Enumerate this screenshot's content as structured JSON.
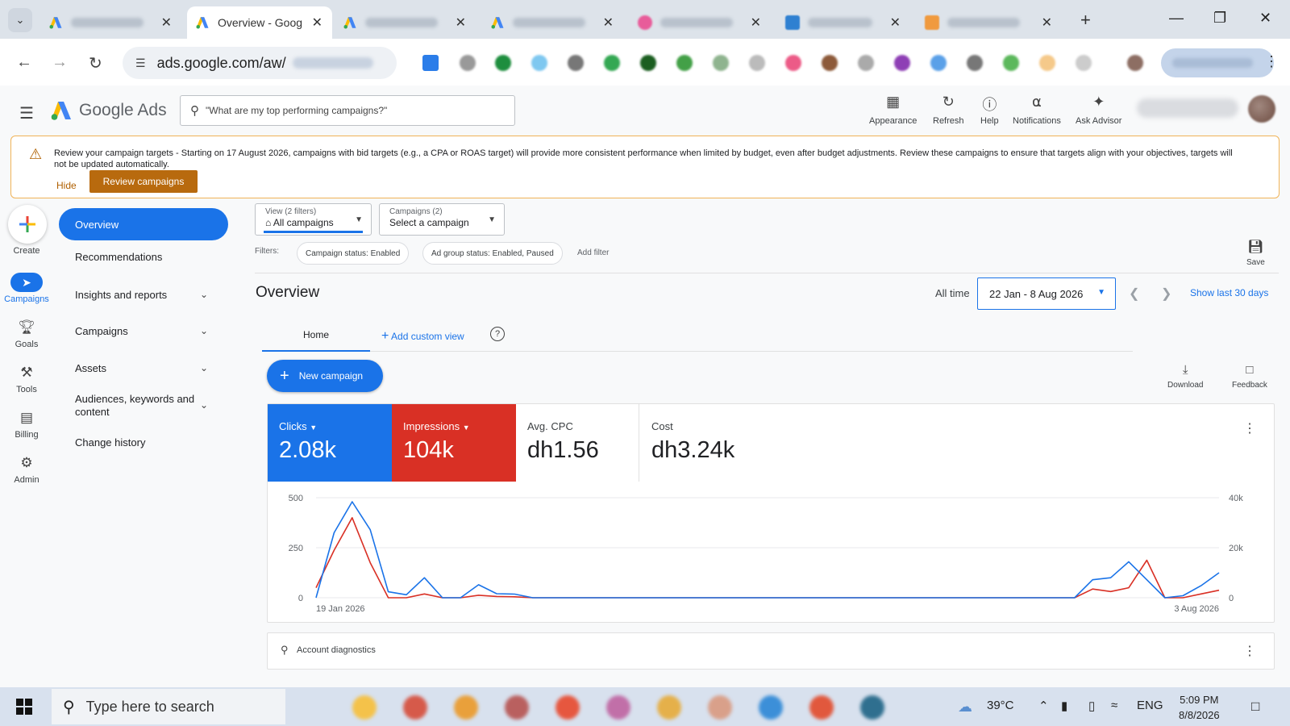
{
  "browser": {
    "active_tab_title": "Overview - Goog",
    "url": "ads.google.com/aw/"
  },
  "header": {
    "app_name": "Google Ads",
    "search_placeholder": "\"What are my top performing campaigns?\"",
    "actions": [
      {
        "label": "Appearance",
        "icon": "appearance-icon"
      },
      {
        "label": "Refresh",
        "icon": "refresh-icon"
      },
      {
        "label": "Help",
        "icon": "help-icon"
      },
      {
        "label": "Notifications",
        "icon": "bell-icon"
      },
      {
        "label": "Ask Advisor",
        "icon": "advisor-icon"
      }
    ]
  },
  "banner": {
    "title": "Review your campaign targets",
    "message": " - Starting on 17 August 2026, campaigns with bid targets (e.g., a CPA or ROAS target) will provide more consistent performance when limited by budget, even after budget adjustments. Review these campaigns to ensure that targets align with your objectives, targets will not be updated automatically.",
    "hide_label": "Hide",
    "review_label": "Review campaigns"
  },
  "rail": {
    "create": "Create",
    "items": [
      {
        "label": "Campaigns",
        "icon": "campaigns-icon",
        "selected": true
      },
      {
        "label": "Goals",
        "icon": "trophy-icon"
      },
      {
        "label": "Tools",
        "icon": "tools-icon"
      },
      {
        "label": "Billing",
        "icon": "billing-icon"
      },
      {
        "label": "Admin",
        "icon": "gear-icon"
      }
    ]
  },
  "nav": {
    "active": "Overview",
    "items": [
      "Recommendations",
      "Insights and reports",
      "Campaigns",
      "Assets",
      "Audiences, keywords and content",
      "Change history"
    ]
  },
  "filterbar": {
    "view_small": "View (2 filters)",
    "view_value": "All campaigns",
    "campaigns_small": "Campaigns (2)",
    "campaigns_value": "Select a campaign",
    "filters_label": "Filters:",
    "chips": [
      "Campaign status: Enabled",
      "Ad group status: Enabled, Paused"
    ],
    "add_filter": "Add filter",
    "save": "Save"
  },
  "overview": {
    "title": "Overview",
    "all_time": "All time",
    "date_range": "22 Jan - 8 Aug 2026",
    "show_last": "Show last 30 days",
    "tab_home": "Home",
    "add_custom_view": "Add custom view",
    "new_campaign": "New campaign",
    "download": "Download",
    "feedback": "Feedback",
    "diagnostics": "Account diagnostics"
  },
  "metrics": [
    {
      "label": "Clicks",
      "value": "2.08k",
      "color": "#1a73e8"
    },
    {
      "label": "Impressions",
      "value": "104k",
      "color": "#d93025"
    },
    {
      "label": "Avg. CPC",
      "value": "dh1.56"
    },
    {
      "label": "Cost",
      "value": "dh3.24k"
    }
  ],
  "chart_data": {
    "type": "line",
    "x_start_label": "19 Jan 2026",
    "x_end_label": "3 Aug 2026",
    "y_left_ticks": [
      "500",
      "250",
      "0"
    ],
    "y_right_ticks": [
      "40k",
      "20k",
      "0"
    ],
    "y_left_range": [
      0,
      500
    ],
    "y_right_range": [
      0,
      40000
    ],
    "grid": true,
    "series": [
      {
        "name": "Clicks",
        "axis": "left",
        "color": "#1a73e8",
        "values": [
          0,
          325,
          480,
          340,
          30,
          15,
          100,
          0,
          0,
          65,
          20,
          18,
          0,
          0,
          0,
          0,
          0,
          0,
          0,
          0,
          0,
          0,
          0,
          0,
          0,
          0,
          0,
          0,
          0,
          0,
          0,
          0,
          0,
          0,
          0,
          0,
          0,
          0,
          0,
          0,
          0,
          0,
          0,
          90,
          100,
          180,
          90,
          0,
          10,
          60,
          125
        ]
      },
      {
        "name": "Impressions",
        "axis": "right",
        "color": "#d93025",
        "values": [
          4000,
          19000,
          32000,
          14000,
          0,
          0,
          1500,
          0,
          0,
          1000,
          500,
          400,
          0,
          0,
          0,
          0,
          0,
          0,
          0,
          0,
          0,
          0,
          0,
          0,
          0,
          0,
          0,
          0,
          0,
          0,
          0,
          0,
          0,
          0,
          0,
          0,
          0,
          0,
          0,
          0,
          0,
          0,
          0,
          3500,
          2500,
          4000,
          15000,
          0,
          0,
          1500,
          3000
        ]
      }
    ]
  },
  "taskbar": {
    "search_placeholder": "Type here to search",
    "weather": "39°C",
    "lang": "ENG",
    "time": "5:09 PM",
    "date": "8/8/2026"
  }
}
